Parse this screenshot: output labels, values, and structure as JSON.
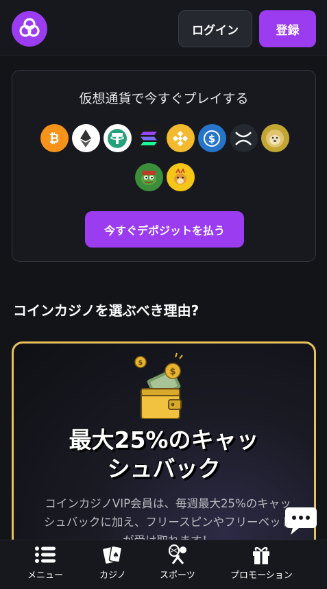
{
  "header": {
    "logo_icon": "coin-casino-logo-icon",
    "login_label": "ログイン",
    "register_label": "登録",
    "accent_color": "#9b3cf0"
  },
  "crypto": {
    "title": "仮想通貨で今すぐプレイする",
    "coins": [
      "bitcoin-icon",
      "ethereum-icon",
      "tether-icon",
      "solana-icon",
      "binance-icon",
      "usdc-icon",
      "xrp-icon",
      "dogecoin-icon",
      "pepe-icon",
      "bonk-icon"
    ],
    "deposit_label": "今すぐデポジットを払う"
  },
  "why": {
    "title": "コインカジノを選ぶべき理由?"
  },
  "promo": {
    "heading_line1": "最大25%のキャッ",
    "heading_line2": "シュバック",
    "description_line1": "コインカジノVIP会員は、毎週最大25%のキャッ",
    "description_line2": "シュバックに加え、フリースピンやフリーベット",
    "description_line3": "が受け取れます！",
    "border_color": "#e8c15c"
  },
  "nav": {
    "menu_label": "メニュー",
    "casino_label": "カジノ",
    "sports_label": "スポーツ",
    "promotions_label": "プロモーション"
  }
}
